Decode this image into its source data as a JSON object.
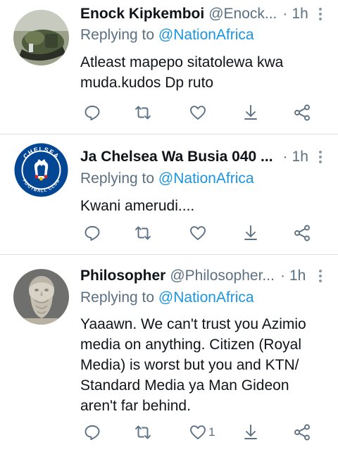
{
  "tweets": [
    {
      "name": "Enock Kipkemboi",
      "handle": "@Enock...",
      "time": "1h",
      "replying_label": "Replying to",
      "replying_to": "@NationAfrica",
      "text": "Atleast mapepo sitatolewa kwa muda.kudos Dp ruto",
      "like_count": ""
    },
    {
      "name": "Ja Chelsea Wa Busia 040 ...",
      "handle": "",
      "time": "1h",
      "replying_label": "Replying to",
      "replying_to": "@NationAfrica",
      "text": "Kwani amerudi....",
      "like_count": ""
    },
    {
      "name": "Philosopher",
      "handle": "@Philosopher...",
      "time": "1h",
      "replying_label": "Replying to",
      "replying_to": "@NationAfrica",
      "text": "Yaaawn. We can't trust you Azimio media on anything. Citizen (Royal Media) is worst but you and KTN/ Standard Media ya Man Gideon aren't far behind.",
      "like_count": "1"
    }
  ],
  "separator": "·",
  "avatar_badge_text": {
    "top": "CHELSEA",
    "bottom": "FOOTBALL CLUB"
  },
  "colors": {
    "text": "#0f1419",
    "secondary": "#5b7083",
    "mention": "#1b95e0",
    "divider": "#d9dfe3",
    "chelsea_blue": "#034694"
  },
  "icons": [
    "reply-icon",
    "retweet-icon",
    "like-icon",
    "share-icon",
    "share-network-icon",
    "more-vertical-icon"
  ]
}
